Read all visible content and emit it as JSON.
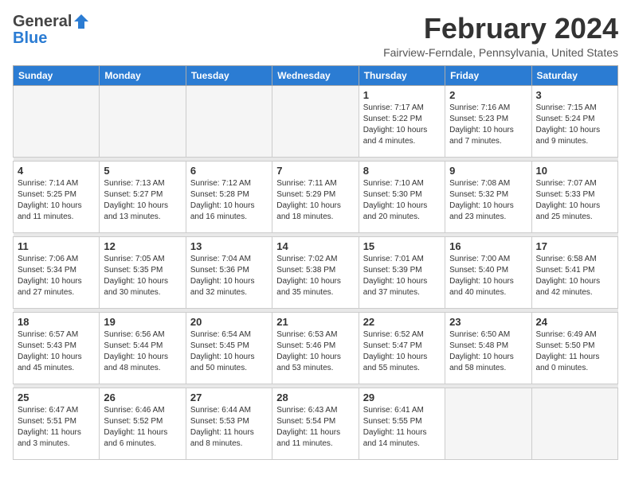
{
  "header": {
    "logo_general": "General",
    "logo_blue": "Blue",
    "month_title": "February 2024",
    "subtitle": "Fairview-Ferndale, Pennsylvania, United States"
  },
  "weekdays": [
    "Sunday",
    "Monday",
    "Tuesday",
    "Wednesday",
    "Thursday",
    "Friday",
    "Saturday"
  ],
  "weeks": [
    [
      {
        "day": "",
        "info": ""
      },
      {
        "day": "",
        "info": ""
      },
      {
        "day": "",
        "info": ""
      },
      {
        "day": "",
        "info": ""
      },
      {
        "day": "1",
        "info": "Sunrise: 7:17 AM\nSunset: 5:22 PM\nDaylight: 10 hours\nand 4 minutes."
      },
      {
        "day": "2",
        "info": "Sunrise: 7:16 AM\nSunset: 5:23 PM\nDaylight: 10 hours\nand 7 minutes."
      },
      {
        "day": "3",
        "info": "Sunrise: 7:15 AM\nSunset: 5:24 PM\nDaylight: 10 hours\nand 9 minutes."
      }
    ],
    [
      {
        "day": "4",
        "info": "Sunrise: 7:14 AM\nSunset: 5:25 PM\nDaylight: 10 hours\nand 11 minutes."
      },
      {
        "day": "5",
        "info": "Sunrise: 7:13 AM\nSunset: 5:27 PM\nDaylight: 10 hours\nand 13 minutes."
      },
      {
        "day": "6",
        "info": "Sunrise: 7:12 AM\nSunset: 5:28 PM\nDaylight: 10 hours\nand 16 minutes."
      },
      {
        "day": "7",
        "info": "Sunrise: 7:11 AM\nSunset: 5:29 PM\nDaylight: 10 hours\nand 18 minutes."
      },
      {
        "day": "8",
        "info": "Sunrise: 7:10 AM\nSunset: 5:30 PM\nDaylight: 10 hours\nand 20 minutes."
      },
      {
        "day": "9",
        "info": "Sunrise: 7:08 AM\nSunset: 5:32 PM\nDaylight: 10 hours\nand 23 minutes."
      },
      {
        "day": "10",
        "info": "Sunrise: 7:07 AM\nSunset: 5:33 PM\nDaylight: 10 hours\nand 25 minutes."
      }
    ],
    [
      {
        "day": "11",
        "info": "Sunrise: 7:06 AM\nSunset: 5:34 PM\nDaylight: 10 hours\nand 27 minutes."
      },
      {
        "day": "12",
        "info": "Sunrise: 7:05 AM\nSunset: 5:35 PM\nDaylight: 10 hours\nand 30 minutes."
      },
      {
        "day": "13",
        "info": "Sunrise: 7:04 AM\nSunset: 5:36 PM\nDaylight: 10 hours\nand 32 minutes."
      },
      {
        "day": "14",
        "info": "Sunrise: 7:02 AM\nSunset: 5:38 PM\nDaylight: 10 hours\nand 35 minutes."
      },
      {
        "day": "15",
        "info": "Sunrise: 7:01 AM\nSunset: 5:39 PM\nDaylight: 10 hours\nand 37 minutes."
      },
      {
        "day": "16",
        "info": "Sunrise: 7:00 AM\nSunset: 5:40 PM\nDaylight: 10 hours\nand 40 minutes."
      },
      {
        "day": "17",
        "info": "Sunrise: 6:58 AM\nSunset: 5:41 PM\nDaylight: 10 hours\nand 42 minutes."
      }
    ],
    [
      {
        "day": "18",
        "info": "Sunrise: 6:57 AM\nSunset: 5:43 PM\nDaylight: 10 hours\nand 45 minutes."
      },
      {
        "day": "19",
        "info": "Sunrise: 6:56 AM\nSunset: 5:44 PM\nDaylight: 10 hours\nand 48 minutes."
      },
      {
        "day": "20",
        "info": "Sunrise: 6:54 AM\nSunset: 5:45 PM\nDaylight: 10 hours\nand 50 minutes."
      },
      {
        "day": "21",
        "info": "Sunrise: 6:53 AM\nSunset: 5:46 PM\nDaylight: 10 hours\nand 53 minutes."
      },
      {
        "day": "22",
        "info": "Sunrise: 6:52 AM\nSunset: 5:47 PM\nDaylight: 10 hours\nand 55 minutes."
      },
      {
        "day": "23",
        "info": "Sunrise: 6:50 AM\nSunset: 5:48 PM\nDaylight: 10 hours\nand 58 minutes."
      },
      {
        "day": "24",
        "info": "Sunrise: 6:49 AM\nSunset: 5:50 PM\nDaylight: 11 hours\nand 0 minutes."
      }
    ],
    [
      {
        "day": "25",
        "info": "Sunrise: 6:47 AM\nSunset: 5:51 PM\nDaylight: 11 hours\nand 3 minutes."
      },
      {
        "day": "26",
        "info": "Sunrise: 6:46 AM\nSunset: 5:52 PM\nDaylight: 11 hours\nand 6 minutes."
      },
      {
        "day": "27",
        "info": "Sunrise: 6:44 AM\nSunset: 5:53 PM\nDaylight: 11 hours\nand 8 minutes."
      },
      {
        "day": "28",
        "info": "Sunrise: 6:43 AM\nSunset: 5:54 PM\nDaylight: 11 hours\nand 11 minutes."
      },
      {
        "day": "29",
        "info": "Sunrise: 6:41 AM\nSunset: 5:55 PM\nDaylight: 11 hours\nand 14 minutes."
      },
      {
        "day": "",
        "info": ""
      },
      {
        "day": "",
        "info": ""
      }
    ]
  ]
}
